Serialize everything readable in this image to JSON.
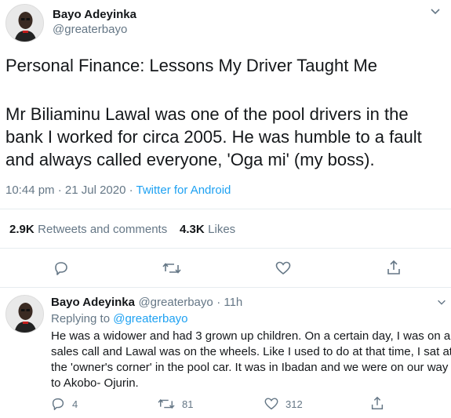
{
  "main_tweet": {
    "author_name": "Bayo Adeyinka",
    "author_handle": "@greaterbayo",
    "title_line": "Personal Finance: Lessons My Driver Taught Me",
    "body_lines": [
      "Mr Biliaminu Lawal was one of the pool drivers in the",
      "bank I worked for circa 2005. He was humble to a fault",
      "and always called everyone, 'Oga mi' (my boss)."
    ],
    "timestamp": "10:44 pm · 21 Jul 2020 ·",
    "source": "Twitter for Android",
    "retweets_count": "2.9K",
    "retweets_label": "Retweets and comments",
    "likes_count": "4.3K",
    "likes_label": "Likes"
  },
  "reply_tweet": {
    "author_name": "Bayo Adeyinka",
    "author_handle": "@greaterbayo",
    "time": "· 11h",
    "replying_prefix": "Replying to",
    "replying_to": "@greaterbayo",
    "body_lines": [
      "He was a widower and had 3 grown up children. On a certain day, I was on a",
      "sales call and Lawal was on the wheels. Like I used to do at that time, I sat at",
      "the 'owner's corner' in the pool car. It was in Ibadan and we were on our way",
      "to Akobo- Ojurin."
    ],
    "reply_count": "4",
    "retweet_count": "81",
    "like_count": "312"
  },
  "colors": {
    "accent": "#1da1f2",
    "secondary_text": "#657786",
    "divider": "#e6ecf0"
  }
}
